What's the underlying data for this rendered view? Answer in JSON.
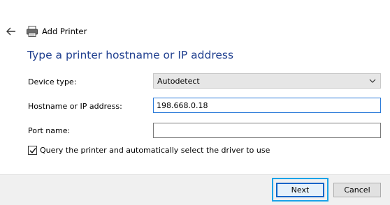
{
  "header": {
    "back_icon": "back-arrow-icon",
    "printer_icon": "printer-icon",
    "title": "Add Printer"
  },
  "main": {
    "page_title": "Type a printer hostname or IP address",
    "device_type": {
      "label": "Device type:",
      "value": "Autodetect",
      "chevron_icon": "chevron-down-icon"
    },
    "hostname": {
      "label": "Hostname or IP address:",
      "value": "198.668.0.18"
    },
    "port": {
      "label": "Port name:",
      "value": ""
    },
    "query_checkbox": {
      "label": "Query the printer and automatically select the driver to use",
      "checked": true
    }
  },
  "footer": {
    "next_label": "Next",
    "cancel_label": "Cancel"
  },
  "colors": {
    "title_blue": "#1f3f8f",
    "highlight": "#1aa3e8",
    "focus_border": "#2b7ad9"
  }
}
